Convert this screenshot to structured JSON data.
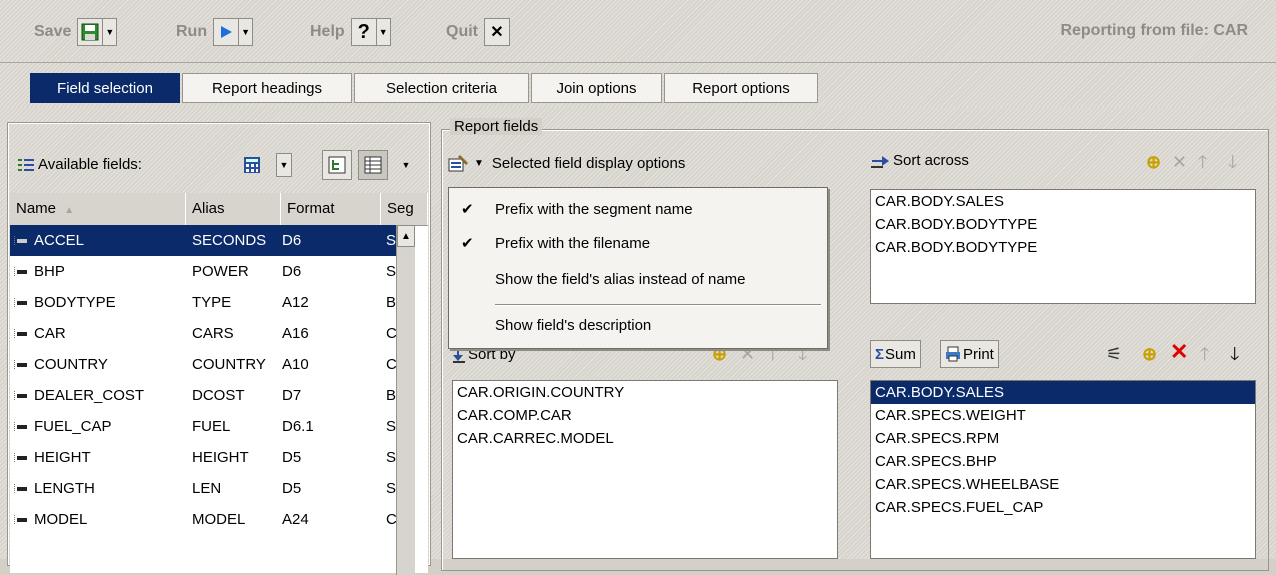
{
  "toolbar": {
    "save_label": "Save",
    "run_label": "Run",
    "help_label": "Help",
    "help_glyph": "?",
    "quit_label": "Quit",
    "quit_glyph": "✕",
    "report_title": "Reporting from file: CAR"
  },
  "tabs": [
    {
      "label": "Field selection",
      "active": true
    },
    {
      "label": "Report headings",
      "active": false
    },
    {
      "label": "Selection criteria",
      "active": false
    },
    {
      "label": "Join options",
      "active": false
    },
    {
      "label": "Report options",
      "active": false
    }
  ],
  "available": {
    "label": "Available fields:",
    "columns": [
      "Name",
      "Alias",
      "Format",
      "Seg"
    ],
    "sort_indicator": "▲",
    "rows": [
      {
        "name": "ACCEL",
        "alias": "SECONDS",
        "format": "D6",
        "seg": "S"
      },
      {
        "name": "BHP",
        "alias": "POWER",
        "format": "D6",
        "seg": "S"
      },
      {
        "name": "BODYTYPE",
        "alias": "TYPE",
        "format": "A12",
        "seg": "B"
      },
      {
        "name": "CAR",
        "alias": "CARS",
        "format": "A16",
        "seg": "C"
      },
      {
        "name": "COUNTRY",
        "alias": "COUNTRY",
        "format": "A10",
        "seg": "C"
      },
      {
        "name": "DEALER_COST",
        "alias": "DCOST",
        "format": "D7",
        "seg": "B"
      },
      {
        "name": "FUEL_CAP",
        "alias": "FUEL",
        "format": "D6.1",
        "seg": "S"
      },
      {
        "name": "HEIGHT",
        "alias": "HEIGHT",
        "format": "D5",
        "seg": "S"
      },
      {
        "name": "LENGTH",
        "alias": "LEN",
        "format": "D5",
        "seg": "S"
      },
      {
        "name": "MODEL",
        "alias": "MODEL",
        "format": "A24",
        "seg": "C"
      }
    ]
  },
  "report_fields": {
    "legend": "Report fields",
    "display_options_label": "Selected field display options",
    "menu": [
      {
        "label": "Prefix with the segment name",
        "checked": "✔"
      },
      {
        "label": "Prefix with the filename",
        "checked": "✔"
      },
      {
        "label": "Show the field's alias instead of name",
        "checked": ""
      },
      {
        "label": "Show field's description",
        "checked": ""
      }
    ],
    "sort_by": {
      "label": "Sort by",
      "items": [
        "CAR.ORIGIN.COUNTRY",
        "CAR.COMP.CAR",
        "CAR.CARREC.MODEL"
      ]
    },
    "sort_across": {
      "label": "Sort across",
      "items": [
        "CAR.BODY.SALES",
        "CAR.BODY.BODYTYPE",
        "CAR.BODY.BODYTYPE"
      ]
    },
    "measures": {
      "sum_label": "Sum",
      "print_label": "Print",
      "items": [
        "CAR.BODY.SALES",
        "CAR.SPECS.WEIGHT",
        "CAR.SPECS.RPM",
        "CAR.SPECS.BHP",
        "CAR.SPECS.WHEELBASE",
        "CAR.SPECS.FUEL_CAP"
      ]
    }
  },
  "colors": {
    "selection": "#0a2a6a",
    "add_icon": "#c8a000",
    "delete_icon": "#e00000",
    "run_icon": "#1d6fe0"
  }
}
